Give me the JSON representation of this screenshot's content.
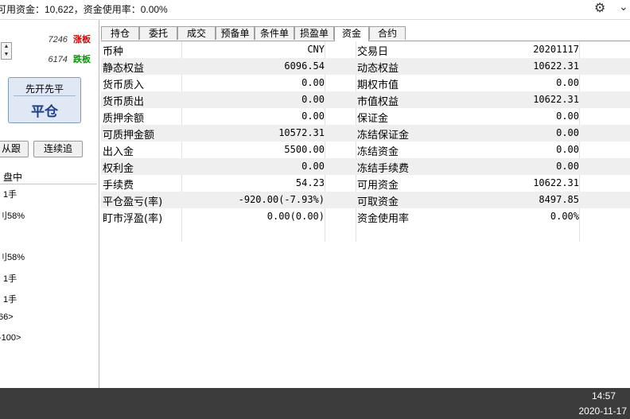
{
  "header": {
    "summary": "可用资金：10,622，资金使用率：0.00%",
    "settings_icon": "gear-icon",
    "collapse_icon": "chevron-down-icon"
  },
  "left_panel": {
    "limit_up": {
      "value": "7246",
      "label": "涨板"
    },
    "limit_down": {
      "value": "6174",
      "label": "跌板"
    },
    "close_button": {
      "mode": "先开先平",
      "label": "平仓"
    },
    "follow_button": "从跟",
    "continuous_button": "连续追",
    "section_title": "盘中",
    "params": [
      "1手",
      "刂58%",
      "刂58%",
      "1手",
      "1手",
      "66>",
      "-100>"
    ]
  },
  "tabs": [
    {
      "label": "持仓",
      "active": false
    },
    {
      "label": "委托",
      "active": false
    },
    {
      "label": "成交",
      "active": false
    },
    {
      "label": "预备单",
      "active": false
    },
    {
      "label": "条件单",
      "active": false
    },
    {
      "label": "损盈单",
      "active": false
    },
    {
      "label": "资金",
      "active": true
    },
    {
      "label": "合约",
      "active": false
    }
  ],
  "fund_table": [
    {
      "label": "币种",
      "value": "CNY",
      "label2": "交易日",
      "value2": "20201117"
    },
    {
      "label": "静态权益",
      "value": "6096.54",
      "label2": "动态权益",
      "value2": "10622.31"
    },
    {
      "label": "货币质入",
      "value": "0.00",
      "label2": "期权市值",
      "value2": "0.00"
    },
    {
      "label": "货币质出",
      "value": "0.00",
      "label2": "市值权益",
      "value2": "10622.31"
    },
    {
      "label": "质押余额",
      "value": "0.00",
      "label2": "保证金",
      "value2": "0.00"
    },
    {
      "label": "可质押金额",
      "value": "10572.31",
      "label2": "冻结保证金",
      "value2": "0.00"
    },
    {
      "label": "出入金",
      "value": "5500.00",
      "label2": "冻结资金",
      "value2": "0.00"
    },
    {
      "label": "权利金",
      "value": "0.00",
      "label2": "冻结手续费",
      "value2": "0.00"
    },
    {
      "label": "手续费",
      "value": "54.23",
      "label2": "可用资金",
      "value2": "10622.31"
    },
    {
      "label": "平仓盈亏(率)",
      "value": "-920.00(-7.93%)",
      "label2": "可取资金",
      "value2": "8497.85"
    },
    {
      "label": "盯市浮盈(率)",
      "value": "0.00(0.00)",
      "label2": "资金使用率",
      "value2": "0.00%"
    }
  ],
  "taskbar": {
    "time": "14:57",
    "date": "2020-11-17"
  },
  "colors": {
    "limit_up": "#e00000",
    "limit_down": "#009a00",
    "close_button_text": "#1d3f8c",
    "row_alt": "#efefef",
    "taskbar": "#3c3c3c"
  }
}
